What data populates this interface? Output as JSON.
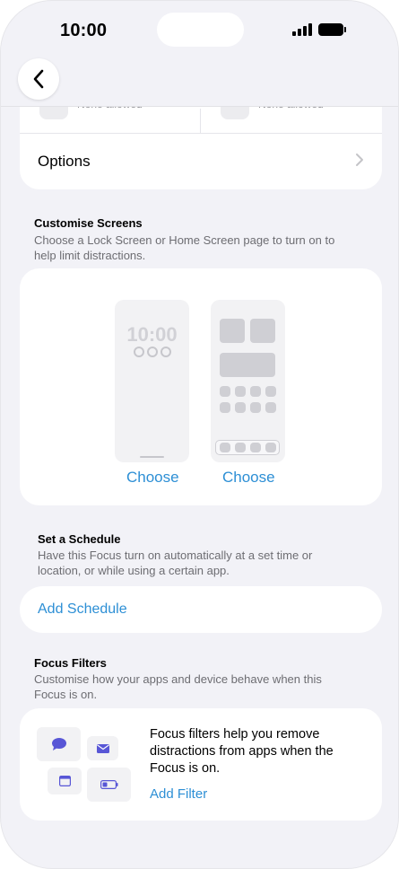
{
  "status_bar": {
    "time": "10:00"
  },
  "nav": {
    "back_label": "Back"
  },
  "top_card": {
    "left_text": "None allowed",
    "right_text": "None allowed",
    "options_label": "Options"
  },
  "customise": {
    "title": "Customise Screens",
    "description_line1": "Choose a Lock Screen or Home Screen page to turn on to",
    "description_line2": "help limit distractions.",
    "lock_preview_time": "10:00",
    "lock_choose": "Choose",
    "home_choose": "Choose"
  },
  "schedule": {
    "title": "Set a Schedule",
    "description_line1": "Have this Focus turn on automatically at a set time or",
    "description_line2": "location, or while using a certain app.",
    "add_label": "Add Schedule"
  },
  "filters": {
    "title": "Focus Filters",
    "description_line1": "Customise how your apps and device behave when this",
    "description_line2": "Focus is on.",
    "body_line1": "Focus filters help you remove",
    "body_line2": "distractions from apps when the",
    "body_line3": "Focus is on.",
    "add_label": "Add Filter",
    "icons": [
      "message-icon",
      "mail-icon",
      "calendar-icon",
      "battery-icon"
    ]
  },
  "colors": {
    "accent": "#2d8fd5",
    "background": "#f2f2f7",
    "filter_icon": "#5856d6"
  }
}
